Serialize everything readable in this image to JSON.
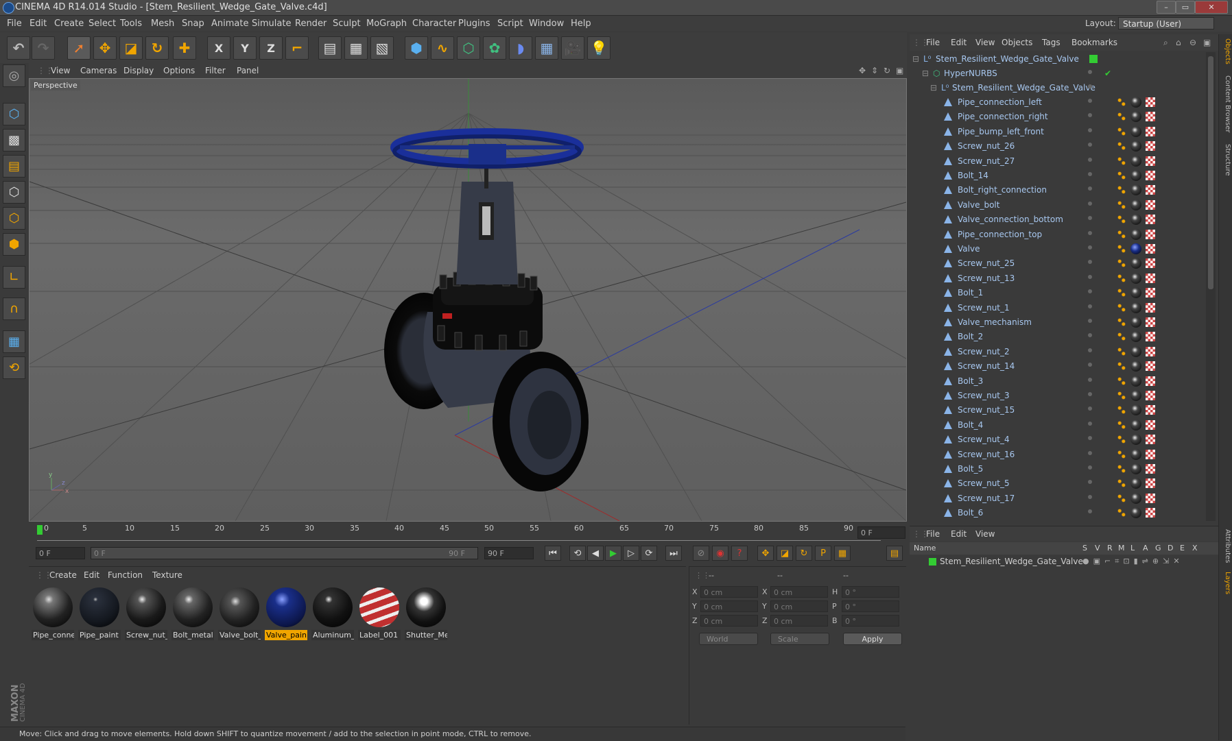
{
  "window": {
    "title": "CINEMA 4D R14.014 Studio - [Stem_Resilient_Wedge_Gate_Valve.c4d]",
    "min": "–",
    "max": "▭",
    "close": "✕"
  },
  "menubar": [
    "File",
    "Edit",
    "Create",
    "Select",
    "Tools",
    "Mesh",
    "Snap",
    "Animate",
    "Simulate",
    "Render",
    "Sculpt",
    "MoGraph",
    "Character",
    "Plugins",
    "Script",
    "Window",
    "Help"
  ],
  "layout": {
    "label": "Layout:",
    "value": "Startup (User)"
  },
  "toolbar": {
    "x_label": "X",
    "y_label": "Y",
    "z_label": "Z"
  },
  "viewport": {
    "menu": [
      "View",
      "Cameras",
      "Display",
      "Options",
      "Filter",
      "Panel"
    ],
    "label": "Perspective"
  },
  "timeline": {
    "ticks": [
      "0",
      "5",
      "10",
      "15",
      "20",
      "25",
      "30",
      "35",
      "40",
      "45",
      "50",
      "55",
      "60",
      "65",
      "70",
      "75",
      "80",
      "85",
      "90"
    ],
    "current_frame": "0 F"
  },
  "transport": {
    "start": "0 F",
    "range_start": "0 F",
    "range_end": "90 F",
    "end": "90 F"
  },
  "materials": {
    "menu": [
      "Create",
      "Edit",
      "Function",
      "Texture"
    ],
    "items": [
      {
        "label": "Pipe_conne",
        "color": "#555"
      },
      {
        "label": "Pipe_paint",
        "color": "#1a1f2a"
      },
      {
        "label": "Screw_nut_",
        "color": "#222"
      },
      {
        "label": "Bolt_metal",
        "color": "#333"
      },
      {
        "label": "Valve_bolt_",
        "color": "#2a2a2a"
      },
      {
        "label": "Valve_pain",
        "color": "#1a2f8a"
      },
      {
        "label": "Aluminum_",
        "color": "#1a1a1a"
      },
      {
        "label": "Label_001",
        "color": "#c03030"
      },
      {
        "label": "Shutter_Me",
        "color": "#1a1a1a"
      }
    ],
    "active_index": 5
  },
  "coords": {
    "header": [
      "--",
      "--",
      "--"
    ],
    "rows": [
      {
        "a": "X",
        "av": "0 cm",
        "b": "X",
        "bv": "0 cm",
        "c": "H",
        "cv": "0 °"
      },
      {
        "a": "Y",
        "av": "0 cm",
        "b": "Y",
        "bv": "0 cm",
        "c": "P",
        "cv": "0 °"
      },
      {
        "a": "Z",
        "av": "0 cm",
        "b": "Z",
        "bv": "0 cm",
        "c": "B",
        "cv": "0 °"
      }
    ],
    "mode": "World",
    "transform": "Scale",
    "apply": "Apply"
  },
  "status": "Move: Click and drag to move elements. Hold down SHIFT to quantize movement / add to the selection in point mode, CTRL to remove.",
  "object_manager": {
    "menu": [
      "File",
      "Edit",
      "View",
      "Objects",
      "Tags",
      "Bookmarks"
    ],
    "root": "Stem_Resilient_Wedge_Gate_Valve",
    "hypernurbs": "HyperNURBS",
    "group": "Stem_Resilient_Wedge_Gate_Valve",
    "objects": [
      "Pipe_connection_left",
      "Pipe_connection_right",
      "Pipe_bump_left_front",
      "Screw_nut_26",
      "Screw_nut_27",
      "Bolt_14",
      "Bolt_right_connection",
      "Valve_bolt",
      "Valve_connection_bottom",
      "Pipe_connection_top",
      "Valve",
      "Screw_nut_25",
      "Screw_nut_13",
      "Bolt_1",
      "Screw_nut_1",
      "Valve_mechanism",
      "Bolt_2",
      "Screw_nut_2",
      "Screw_nut_14",
      "Bolt_3",
      "Screw_nut_3",
      "Screw_nut_15",
      "Bolt_4",
      "Screw_nut_4",
      "Screw_nut_16",
      "Bolt_5",
      "Screw_nut_5",
      "Screw_nut_17",
      "Bolt_6"
    ]
  },
  "layers": {
    "menu": [
      "File",
      "Edit",
      "View"
    ],
    "columns": [
      "Name",
      "S",
      "V",
      "R",
      "M",
      "L",
      "A",
      "G",
      "D",
      "E",
      "X"
    ],
    "row": "Stem_Resilient_Wedge_Gate_Valve"
  },
  "side_tabs": [
    "Objects",
    "Content Browser",
    "Structure",
    "Attributes",
    "Layers"
  ],
  "branding": {
    "logo": "MAXON CINEMA 4D"
  },
  "colors": {
    "accent": "#f0a500",
    "valve_blue": "#1a2f8a",
    "object_text": "#a8c8f0"
  }
}
